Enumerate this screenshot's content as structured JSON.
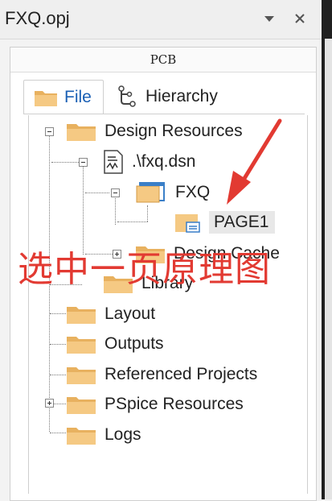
{
  "window": {
    "title": "FXQ.opj"
  },
  "panel": {
    "header": "PCB"
  },
  "tabs": [
    {
      "label": "File"
    },
    {
      "label": "Hierarchy"
    }
  ],
  "tree": {
    "design_resources": "Design Resources",
    "dsn": ".\\fxq.dsn",
    "fxq": "FXQ",
    "page1": "PAGE1",
    "design_cache": "Design Cache",
    "library": "Library",
    "layout": "Layout",
    "outputs": "Outputs",
    "referenced_projects": "Referenced Projects",
    "pspice_resources": "PSpice Resources",
    "logs": "Logs"
  },
  "annotation": {
    "text": "选中一页原理图"
  },
  "colors": {
    "annotation": "#e23a32",
    "folder": "#f2c27a",
    "accent": "#1a5fb4"
  }
}
